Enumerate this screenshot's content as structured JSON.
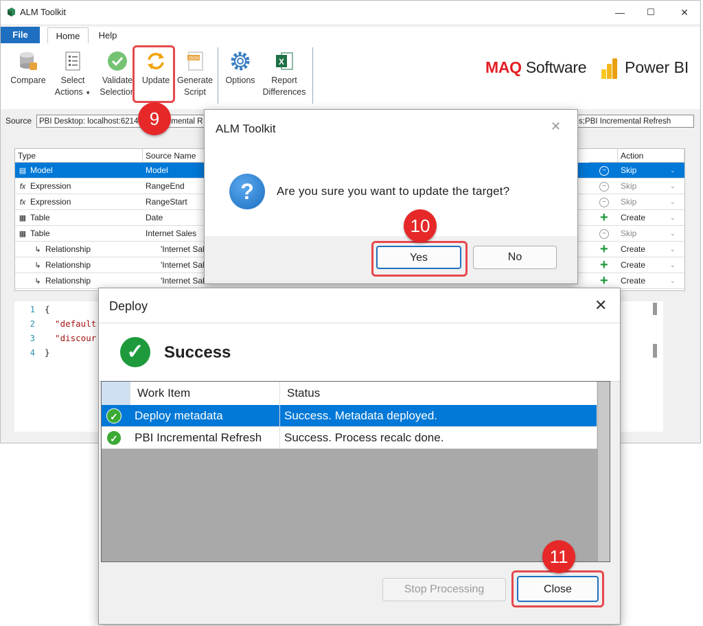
{
  "window": {
    "title": "ALM Toolkit"
  },
  "menu": {
    "file": "File",
    "home": "Home",
    "help": "Help"
  },
  "ribbon": {
    "compare": "Compare",
    "select_actions_1": "Select",
    "select_actions_2": "Actions",
    "validate_1": "Validate",
    "validate_2": "Selection",
    "update": "Update",
    "generate_1": "Generate",
    "generate_2": "Script",
    "options": "Options",
    "report_1": "Report",
    "report_2": "Differences",
    "json_tag": "JSON",
    "excel_tag": "X"
  },
  "brand": {
    "maq_bold": "MAQ",
    "maq_rest": " Software",
    "powerbi": "Power BI"
  },
  "source": {
    "label": "Source",
    "value": "PBI Desktop: localhost:62145 ... Incremental R",
    "target_value": "s;PBI Incremental Refresh"
  },
  "grid": {
    "headers": {
      "type": "Type",
      "source_name": "Source Name",
      "action": "Action"
    },
    "rows": [
      {
        "type": "Model",
        "source": "Model",
        "action": "Skip"
      },
      {
        "type": "Expression",
        "source": "RangeEnd",
        "action": "Skip"
      },
      {
        "type": "Expression",
        "source": "RangeStart",
        "action": "Skip"
      },
      {
        "type": "Table",
        "source": "Date",
        "action": "Create"
      },
      {
        "type": "Table",
        "source": "Internet Sales",
        "action": "Skip"
      },
      {
        "type": "Relationship",
        "source": "'Internet Sal",
        "action": "Create"
      },
      {
        "type": "Relationship",
        "source": "'Internet Sal",
        "action": "Create"
      },
      {
        "type": "Relationship",
        "source": "'Internet Sal",
        "action": "Create"
      }
    ]
  },
  "code": {
    "lines": [
      "1",
      "2",
      "3",
      "4"
    ],
    "l1": "{",
    "l2": "  \"default",
    "l3": "  \"discour",
    "l4": "}"
  },
  "confirm": {
    "title": "ALM Toolkit",
    "question": "Are you sure you want to update the target?",
    "yes": "Yes",
    "no": "No"
  },
  "deploy": {
    "title": "Deploy",
    "status": "Success",
    "col_work": "Work Item",
    "col_status": "Status",
    "rows": [
      {
        "item": "Deploy metadata",
        "status": "Success. Metadata deployed."
      },
      {
        "item": "PBI Incremental Refresh",
        "status": "Success. Process recalc done."
      }
    ],
    "stop": "Stop Processing",
    "close": "Close"
  },
  "badges": {
    "step9": "9",
    "step10": "10",
    "step11": "11"
  },
  "colors": {
    "accent": "#0078d7",
    "callout": "#e62828",
    "success": "#1e9a3c"
  }
}
